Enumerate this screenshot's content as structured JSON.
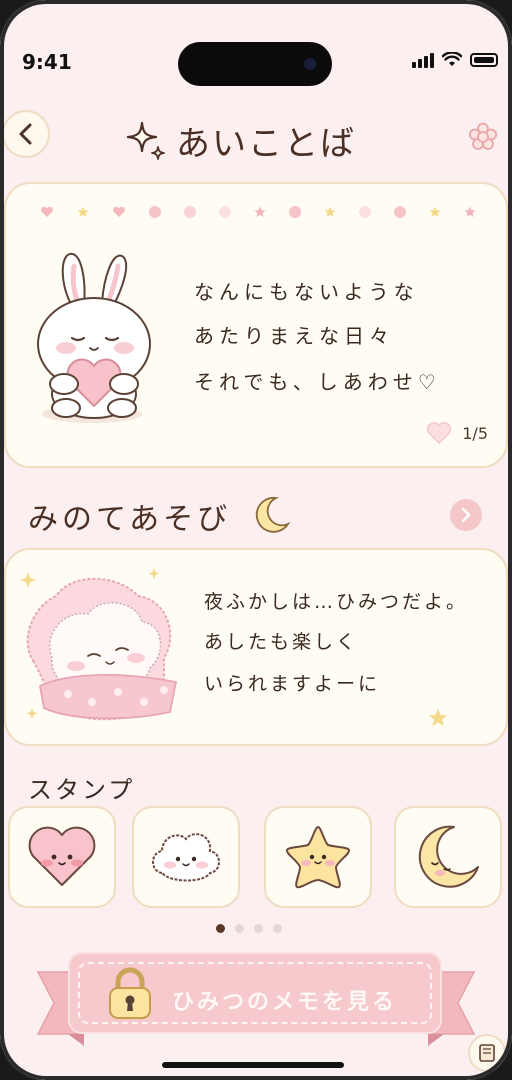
{
  "status": {
    "time": "9:41"
  },
  "header": {
    "title": "あいことば"
  },
  "quote_card": {
    "lines": [
      "なんにもないような",
      "あたりまえな日々",
      "それでも、しあわせ♡"
    ],
    "page": "1/5"
  },
  "night_section": {
    "title": "みのてあそび",
    "lines": [
      "夜ふかしは…ひみつだよ。",
      "あしたも楽しく",
      "いられますよーに"
    ]
  },
  "stamps": {
    "title": "スタンプ",
    "items": [
      "heart-stamp",
      "cloud-stamp",
      "star-stamp",
      "moon-stamp"
    ]
  },
  "pagination": {
    "active": 0,
    "count": 4
  },
  "memo_button": {
    "label": "ひみつのメモを見る"
  },
  "colors": {
    "background": "#fbeff0",
    "card": "#fffcf4",
    "accent_pink": "#f6c9cc",
    "text": "#4b2f24"
  }
}
